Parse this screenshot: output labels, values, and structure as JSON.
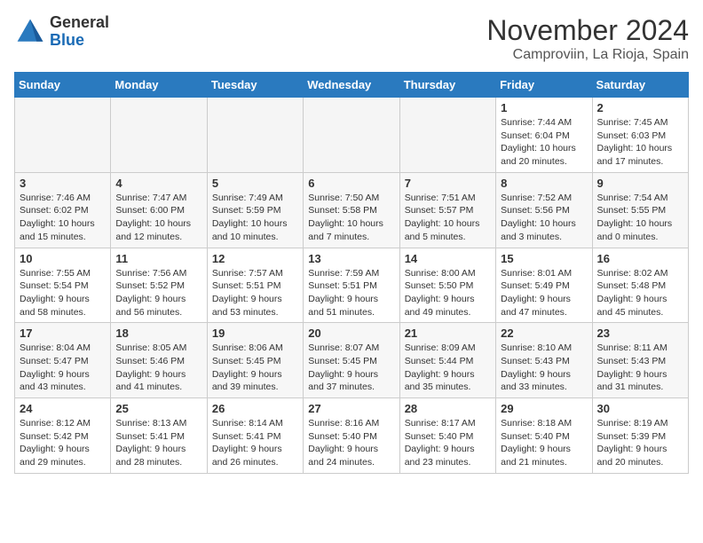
{
  "logo": {
    "general": "General",
    "blue": "Blue"
  },
  "title": "November 2024",
  "location": "Camproviin, La Rioja, Spain",
  "weekdays": [
    "Sunday",
    "Monday",
    "Tuesday",
    "Wednesday",
    "Thursday",
    "Friday",
    "Saturday"
  ],
  "weeks": [
    [
      {
        "day": "",
        "info": ""
      },
      {
        "day": "",
        "info": ""
      },
      {
        "day": "",
        "info": ""
      },
      {
        "day": "",
        "info": ""
      },
      {
        "day": "",
        "info": ""
      },
      {
        "day": "1",
        "info": "Sunrise: 7:44 AM\nSunset: 6:04 PM\nDaylight: 10 hours\nand 20 minutes."
      },
      {
        "day": "2",
        "info": "Sunrise: 7:45 AM\nSunset: 6:03 PM\nDaylight: 10 hours\nand 17 minutes."
      }
    ],
    [
      {
        "day": "3",
        "info": "Sunrise: 7:46 AM\nSunset: 6:02 PM\nDaylight: 10 hours\nand 15 minutes."
      },
      {
        "day": "4",
        "info": "Sunrise: 7:47 AM\nSunset: 6:00 PM\nDaylight: 10 hours\nand 12 minutes."
      },
      {
        "day": "5",
        "info": "Sunrise: 7:49 AM\nSunset: 5:59 PM\nDaylight: 10 hours\nand 10 minutes."
      },
      {
        "day": "6",
        "info": "Sunrise: 7:50 AM\nSunset: 5:58 PM\nDaylight: 10 hours\nand 7 minutes."
      },
      {
        "day": "7",
        "info": "Sunrise: 7:51 AM\nSunset: 5:57 PM\nDaylight: 10 hours\nand 5 minutes."
      },
      {
        "day": "8",
        "info": "Sunrise: 7:52 AM\nSunset: 5:56 PM\nDaylight: 10 hours\nand 3 minutes."
      },
      {
        "day": "9",
        "info": "Sunrise: 7:54 AM\nSunset: 5:55 PM\nDaylight: 10 hours\nand 0 minutes."
      }
    ],
    [
      {
        "day": "10",
        "info": "Sunrise: 7:55 AM\nSunset: 5:54 PM\nDaylight: 9 hours\nand 58 minutes."
      },
      {
        "day": "11",
        "info": "Sunrise: 7:56 AM\nSunset: 5:52 PM\nDaylight: 9 hours\nand 56 minutes."
      },
      {
        "day": "12",
        "info": "Sunrise: 7:57 AM\nSunset: 5:51 PM\nDaylight: 9 hours\nand 53 minutes."
      },
      {
        "day": "13",
        "info": "Sunrise: 7:59 AM\nSunset: 5:51 PM\nDaylight: 9 hours\nand 51 minutes."
      },
      {
        "day": "14",
        "info": "Sunrise: 8:00 AM\nSunset: 5:50 PM\nDaylight: 9 hours\nand 49 minutes."
      },
      {
        "day": "15",
        "info": "Sunrise: 8:01 AM\nSunset: 5:49 PM\nDaylight: 9 hours\nand 47 minutes."
      },
      {
        "day": "16",
        "info": "Sunrise: 8:02 AM\nSunset: 5:48 PM\nDaylight: 9 hours\nand 45 minutes."
      }
    ],
    [
      {
        "day": "17",
        "info": "Sunrise: 8:04 AM\nSunset: 5:47 PM\nDaylight: 9 hours\nand 43 minutes."
      },
      {
        "day": "18",
        "info": "Sunrise: 8:05 AM\nSunset: 5:46 PM\nDaylight: 9 hours\nand 41 minutes."
      },
      {
        "day": "19",
        "info": "Sunrise: 8:06 AM\nSunset: 5:45 PM\nDaylight: 9 hours\nand 39 minutes."
      },
      {
        "day": "20",
        "info": "Sunrise: 8:07 AM\nSunset: 5:45 PM\nDaylight: 9 hours\nand 37 minutes."
      },
      {
        "day": "21",
        "info": "Sunrise: 8:09 AM\nSunset: 5:44 PM\nDaylight: 9 hours\nand 35 minutes."
      },
      {
        "day": "22",
        "info": "Sunrise: 8:10 AM\nSunset: 5:43 PM\nDaylight: 9 hours\nand 33 minutes."
      },
      {
        "day": "23",
        "info": "Sunrise: 8:11 AM\nSunset: 5:43 PM\nDaylight: 9 hours\nand 31 minutes."
      }
    ],
    [
      {
        "day": "24",
        "info": "Sunrise: 8:12 AM\nSunset: 5:42 PM\nDaylight: 9 hours\nand 29 minutes."
      },
      {
        "day": "25",
        "info": "Sunrise: 8:13 AM\nSunset: 5:41 PM\nDaylight: 9 hours\nand 28 minutes."
      },
      {
        "day": "26",
        "info": "Sunrise: 8:14 AM\nSunset: 5:41 PM\nDaylight: 9 hours\nand 26 minutes."
      },
      {
        "day": "27",
        "info": "Sunrise: 8:16 AM\nSunset: 5:40 PM\nDaylight: 9 hours\nand 24 minutes."
      },
      {
        "day": "28",
        "info": "Sunrise: 8:17 AM\nSunset: 5:40 PM\nDaylight: 9 hours\nand 23 minutes."
      },
      {
        "day": "29",
        "info": "Sunrise: 8:18 AM\nSunset: 5:40 PM\nDaylight: 9 hours\nand 21 minutes."
      },
      {
        "day": "30",
        "info": "Sunrise: 8:19 AM\nSunset: 5:39 PM\nDaylight: 9 hours\nand 20 minutes."
      }
    ]
  ]
}
